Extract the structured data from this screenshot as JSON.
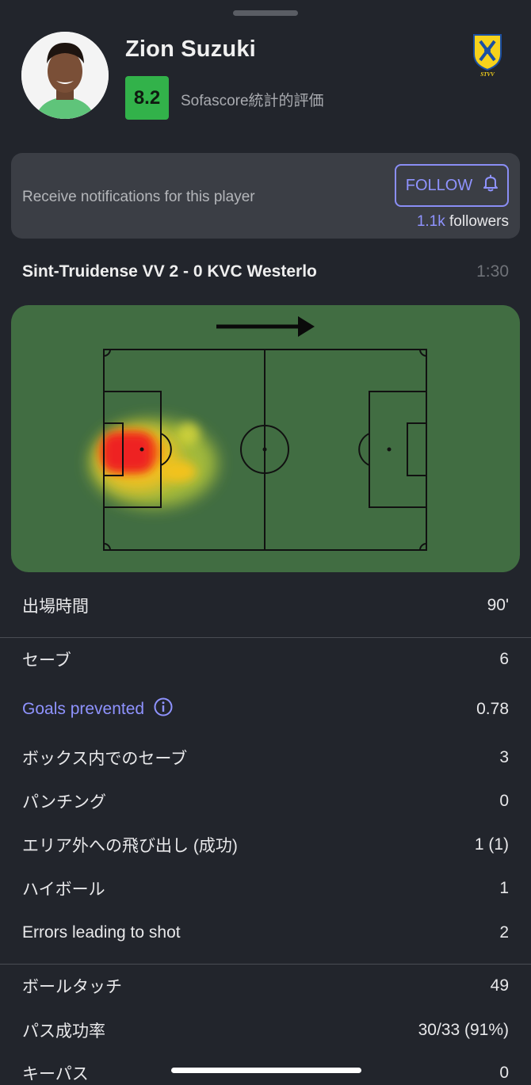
{
  "player": {
    "name": "Zion Suzuki",
    "rating": "8.2",
    "rating_label": "Sofascore統計的評価",
    "club_badge_text": "STVV"
  },
  "notifications": {
    "text": "Receive notifications for this player",
    "follow_label": "FOLLOW",
    "followers_count": "1.1k",
    "followers_label": " followers"
  },
  "match": {
    "title": "Sint-Truidense VV 2 - 0 KVC Westerlo",
    "time": "1:30"
  },
  "stats": [
    {
      "label": "出場時間",
      "value": "90'"
    },
    {
      "label": "セーブ",
      "value": "6"
    },
    {
      "label": "Goals prevented",
      "value": "0.78"
    },
    {
      "label": "ボックス内でのセーブ",
      "value": "3"
    },
    {
      "label": "パンチング",
      "value": "0"
    },
    {
      "label": "エリア外への飛び出し (成功)",
      "value": "1 (1)"
    },
    {
      "label": "ハイボール",
      "value": "1"
    },
    {
      "label": "Errors leading to shot",
      "value": "2"
    },
    {
      "label": "ボールタッチ",
      "value": "49"
    },
    {
      "label": "パス成功率",
      "value": "30/33 (91%)"
    },
    {
      "label": "キーパス",
      "value": "0"
    }
  ],
  "colors": {
    "background": "#22252c",
    "accent": "#8f93ff",
    "rating_green": "#32b24a",
    "pitch_green": "#416d42"
  },
  "icons": [
    "bell-icon",
    "info-icon",
    "arrow-right-icon"
  ]
}
